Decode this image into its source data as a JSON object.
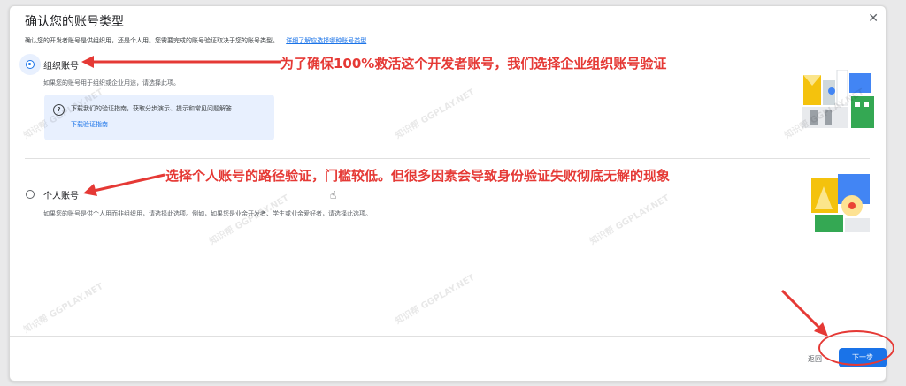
{
  "dialog": {
    "title": "确认您的账号类型",
    "close_icon": "close-icon",
    "subtitle": "确认您的开发者账号是供组织用，还是个人用。您需要完成的账号验证取决于您的账号类型。",
    "subtitle_link": "详细了解应选择哪种账号类型"
  },
  "options": [
    {
      "label": "组织账号",
      "selected": true,
      "description": "如果您的账号用于组织或企业用途，请选择此项。",
      "info_box": {
        "icon": "help-icon",
        "text": "下载我们的验证指南，获取分步演示、提示和常见问题解答",
        "link": "下载验证指南"
      }
    },
    {
      "label": "个人账号",
      "selected": false,
      "description": "如果您的账号是供个人用而非组织用，请选择此选项。例如，如果您是业余开发者、学生或业余爱好者，请选择此选项。"
    }
  ],
  "annotations": {
    "first": "为了确保100%救活这个开发者账号，我们选择企业组织账号验证",
    "second": "选择个人账号的路径验证，门槛较低。但很多因素会导致身份验证失败彻底无解的现象",
    "color": "#e53935"
  },
  "footer": {
    "back_label": "返回",
    "next_label": "下一步"
  },
  "watermark": "知识帮 GGPLAY.NET",
  "colors": {
    "accent": "#1a73e8",
    "annotation_red": "#e53935"
  }
}
